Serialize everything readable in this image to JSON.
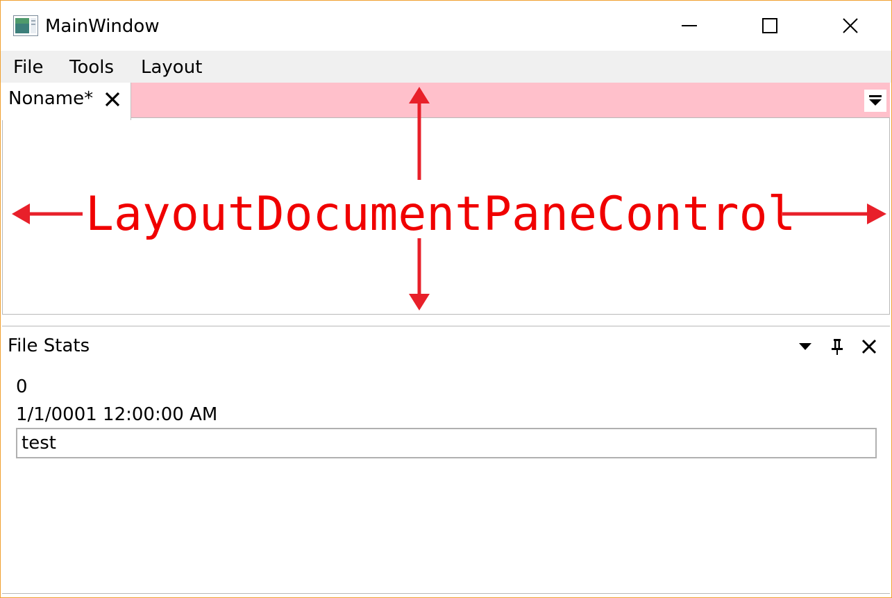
{
  "window": {
    "title": "MainWindow"
  },
  "menu": {
    "items": [
      {
        "label": "File"
      },
      {
        "label": "Tools"
      },
      {
        "label": "Layout"
      }
    ]
  },
  "document_pane": {
    "tabs": [
      {
        "title": "Noname*"
      }
    ],
    "tabstrip_color": "#ffc0cb",
    "annotation": {
      "label": "LayoutDocumentPaneControl",
      "color": "#f00000"
    }
  },
  "anchorable_pane": {
    "title": "File Stats",
    "stats": {
      "count": "0",
      "date": "1/1/0001 12:00:00 AM"
    },
    "input": {
      "value": "test"
    }
  },
  "icons": {
    "app": "app-icon",
    "minimize": "minimize-icon",
    "maximize": "maximize-icon",
    "close": "close-icon",
    "tab_close": "close-icon",
    "doc_menu": "dropdown-menu-icon",
    "pane_menu": "chevron-down-icon",
    "pane_pin": "pin-icon",
    "pane_close": "close-icon"
  },
  "colors": {
    "window_border": "#f0a030",
    "menubar_bg": "#f0f0f0",
    "pane_border": "#b8b8b8"
  }
}
